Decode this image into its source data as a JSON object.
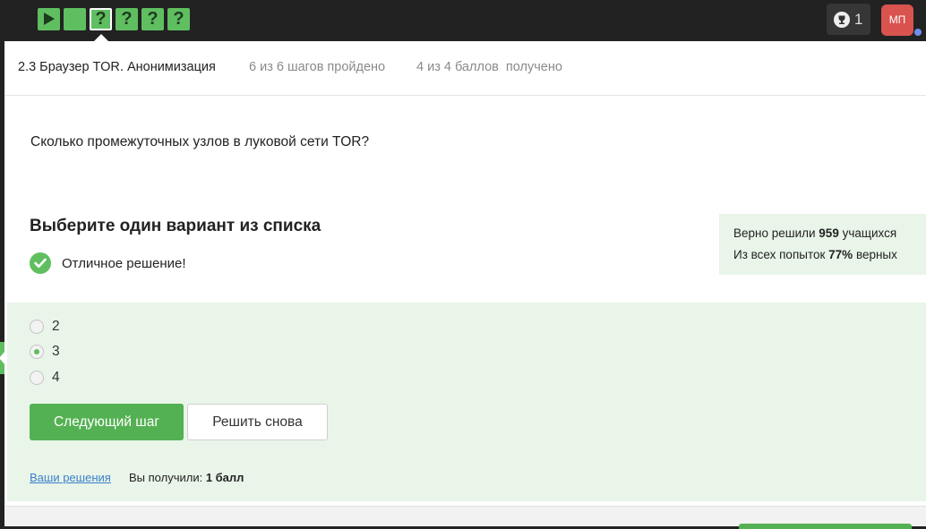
{
  "topbar": {
    "steps": [
      {
        "type": "video",
        "glyph": ""
      },
      {
        "type": "text",
        "glyph": ""
      },
      {
        "type": "quiz",
        "glyph": "?",
        "current": true
      },
      {
        "type": "quiz",
        "glyph": "?"
      },
      {
        "type": "quiz",
        "glyph": "?"
      },
      {
        "type": "quiz",
        "glyph": "?"
      }
    ],
    "trophy_count": "1",
    "avatar_initials": "МП",
    "colors": {
      "bar": "#222222",
      "step": "#5fbf60",
      "avatar": "#d9534f"
    }
  },
  "header": {
    "lesson_title": "2.3 Браузер TOR. Анонимизация",
    "steps_done": "6 из 6 шагов пройдено",
    "points": "4 из 4 баллов  получено"
  },
  "question": {
    "text": "Сколько промежуточных узлов в луковой сети TOR?",
    "choose_title": "Выберите один вариант из списка",
    "feedback": "Отличное решение!"
  },
  "stats": {
    "line1_prefix": "Верно решили ",
    "line1_value": "959",
    "line1_suffix": " учащихся",
    "line2_prefix": "Из всех попыток ",
    "line2_value": "77%",
    "line2_suffix": " верных"
  },
  "options": [
    {
      "label": "2",
      "checked": false
    },
    {
      "label": "3",
      "checked": true
    },
    {
      "label": "4",
      "checked": false
    }
  ],
  "actions": {
    "next_step": "Следующий шаг",
    "solve_again": "Решить снова",
    "your_solutions": "Ваши решения",
    "result_prefix": "Вы получили: ",
    "result_value": "1 балл"
  }
}
